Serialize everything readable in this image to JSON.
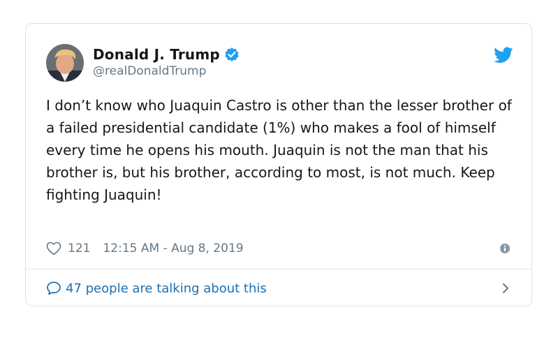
{
  "tweet": {
    "display_name": "Donald J. Trump",
    "handle": "@realDonaldTrump",
    "verified": true,
    "text": "I don’t know who Juaquin Castro is other than the lesser brother of a failed presidential candidate (1%) who makes a fool of himself every time he opens his mouth. Juaquin is not the man that his brother is, but his brother, according to most, is not much. Keep fighting Juaquin!",
    "like_count": "121",
    "timestamp": "12:15 AM - Aug 8, 2019",
    "talking_label": "47 people are talking about this"
  },
  "icons": {
    "verified": "verified-badge-icon",
    "brand": "twitter-bird-icon",
    "like": "heart-icon",
    "info": "info-icon",
    "reply": "speech-bubble-icon",
    "chevron": "chevron-right-icon"
  },
  "colors": {
    "brand_blue": "#1da1f2",
    "link_blue": "#1b6fb3",
    "muted_gray": "#657786",
    "text_black": "#14171a"
  }
}
